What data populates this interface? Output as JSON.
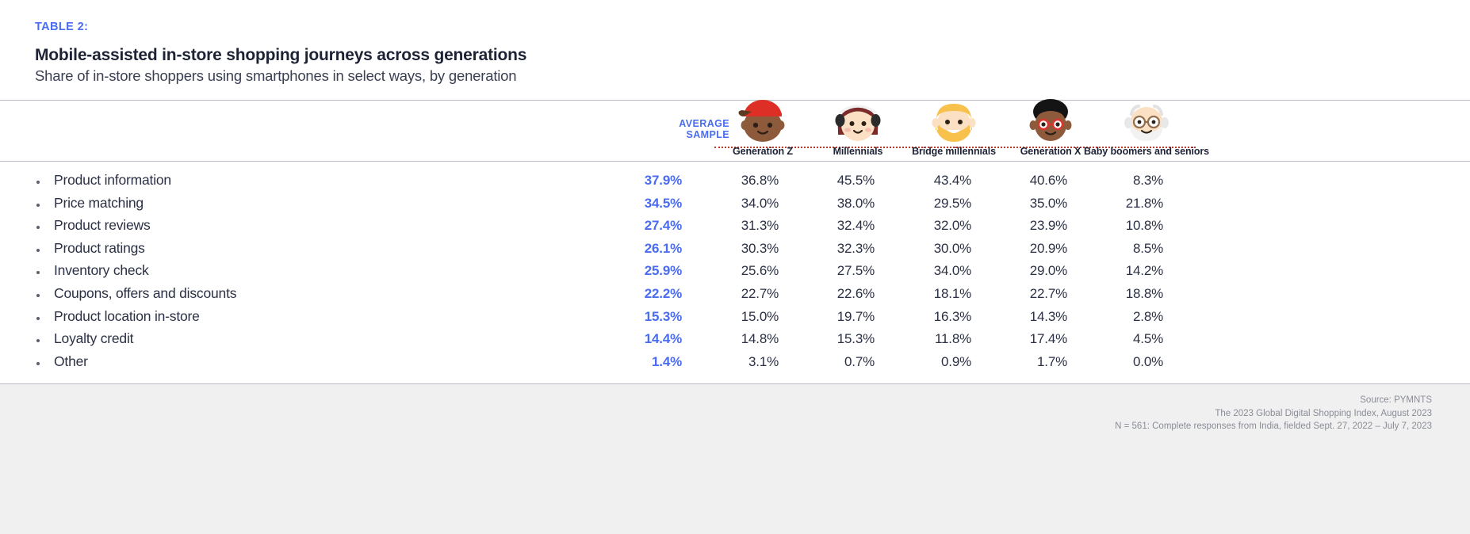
{
  "header": {
    "table_label": "TABLE 2:",
    "title": "Mobile-assisted in-store shopping journeys across generations",
    "subtitle": "Share of in-store shoppers using smartphones in select ways, by generation"
  },
  "columns": {
    "average_label_line1": "AVERAGE",
    "average_label_line2": "SAMPLE",
    "generations": [
      {
        "label": "Generation Z",
        "icon": "avatar-gen-z-icon"
      },
      {
        "label": "Millennials",
        "icon": "avatar-millennials-icon"
      },
      {
        "label": "Bridge millennials",
        "icon": "avatar-bridge-millennials-icon"
      },
      {
        "label": "Generation X",
        "icon": "avatar-gen-x-icon"
      },
      {
        "label": "Baby boomers\nand seniors",
        "icon": "avatar-baby-boomers-icon"
      }
    ]
  },
  "chart_data": {
    "type": "table",
    "title": "Mobile-assisted in-store shopping journeys across generations",
    "subtitle": "Share of in-store shoppers using smartphones in select ways, by generation",
    "categories": [
      "Product information",
      "Price matching",
      "Product reviews",
      "Product ratings",
      "Inventory check",
      "Coupons, offers and discounts",
      "Product location in-store",
      "Loyalty credit",
      "Other"
    ],
    "series": [
      {
        "name": "Average sample",
        "values": [
          "37.9%",
          "34.5%",
          "27.4%",
          "26.1%",
          "25.9%",
          "22.2%",
          "15.3%",
          "14.4%",
          "1.4%"
        ]
      },
      {
        "name": "Generation Z",
        "values": [
          "36.8%",
          "34.0%",
          "31.3%",
          "30.3%",
          "25.6%",
          "22.7%",
          "15.0%",
          "14.8%",
          "3.1%"
        ]
      },
      {
        "name": "Millennials",
        "values": [
          "45.5%",
          "38.0%",
          "32.4%",
          "32.3%",
          "27.5%",
          "22.6%",
          "19.7%",
          "15.3%",
          "0.7%"
        ]
      },
      {
        "name": "Bridge millennials",
        "values": [
          "43.4%",
          "29.5%",
          "32.0%",
          "30.0%",
          "34.0%",
          "18.1%",
          "16.3%",
          "11.8%",
          "0.9%"
        ]
      },
      {
        "name": "Generation X",
        "values": [
          "40.6%",
          "35.0%",
          "23.9%",
          "20.9%",
          "29.0%",
          "22.7%",
          "14.3%",
          "17.4%",
          "1.7%"
        ]
      },
      {
        "name": "Baby boomers and seniors",
        "values": [
          "8.3%",
          "21.8%",
          "10.8%",
          "8.5%",
          "14.2%",
          "18.8%",
          "2.8%",
          "4.5%",
          "0.0%"
        ]
      }
    ]
  },
  "footer": {
    "source_line1": "Source: PYMNTS",
    "source_line2": "The 2023 Global Digital Shopping Index, August 2023",
    "source_line3": "N = 561: Complete responses from India, fielded Sept. 27, 2022 – July 7, 2023"
  },
  "colors": {
    "accent_blue": "#4a6cf0",
    "text_dark": "#2b3044",
    "rule_grey": "#b9bcc4",
    "footer_bg": "#f0f0f0",
    "dotted_line": "#c0392b"
  }
}
